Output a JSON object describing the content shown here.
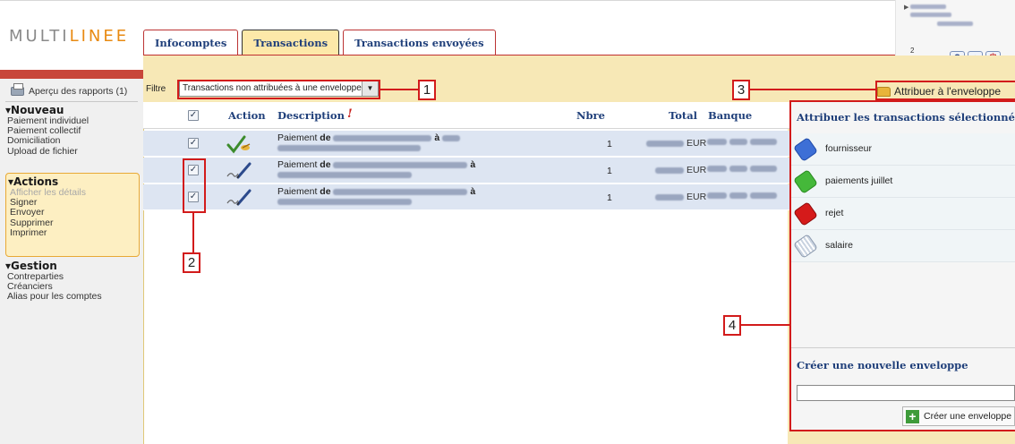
{
  "app": {
    "logo_text_gray": "MULTI",
    "logo_text_accent": "LINE",
    "logo_tail": "E"
  },
  "tabs": [
    {
      "label": "Infocomptes",
      "active": false
    },
    {
      "label": "Transactions",
      "active": true
    },
    {
      "label": "Transactions envoyées",
      "active": false
    }
  ],
  "header_buttons": {
    "help_icon": "?",
    "home_icon": "⌂",
    "logout_icon": "⏻",
    "mail_count": "2"
  },
  "sidebar": {
    "report_link": "Aperçu des rapports (1)",
    "nouveau": {
      "title": "▾Nouveau",
      "items": [
        "Paiement individuel",
        "Paiement collectif",
        "Domiciliation",
        "Upload de fichier"
      ]
    },
    "actions": {
      "title": "▾Actions",
      "items": [
        "Afficher les détails",
        "Signer",
        "Envoyer",
        "Supprimer",
        "Imprimer"
      ]
    },
    "gestion": {
      "title": "▾Gestion",
      "items": [
        "Contreparties",
        "Créanciers",
        "Alias pour les comptes"
      ]
    }
  },
  "filter": {
    "label": "Filtre",
    "selected": "Transactions non attribuées à une enveloppe"
  },
  "assign_button": {
    "label": "Attribuer à l'enveloppe"
  },
  "table": {
    "headers": {
      "flag": "!",
      "action": "Action",
      "description": "Description",
      "nbre": "Nbre",
      "total": "Total",
      "bank": "Banque"
    },
    "rows": [
      {
        "desc_prefix": "Paiement ",
        "desc_bold": "de",
        "desc_mid": " à",
        "nbre": "1",
        "currency": "EUR",
        "checked": true,
        "action": "signed"
      },
      {
        "desc_prefix": "Paiement ",
        "desc_bold": "de",
        "desc_mid": " à",
        "nbre": "1",
        "currency": "EUR",
        "checked": true,
        "action": "sign"
      },
      {
        "desc_prefix": "Paiement ",
        "desc_bold": "de",
        "desc_mid": " à",
        "nbre": "1",
        "currency": "EUR",
        "checked": true,
        "action": "sign"
      }
    ]
  },
  "envelopes": {
    "title": "Attribuer les transactions sélectionnées à",
    "items": [
      {
        "label": "fournisseur",
        "color": "#3d6fd6"
      },
      {
        "label": "paiements juillet",
        "color": "#45b83a"
      },
      {
        "label": "rejet",
        "color": "#d51a1a"
      },
      {
        "label": "salaire",
        "color": "#c9d3e0"
      }
    ],
    "new_title": "Créer une nouvelle enveloppe",
    "new_input_value": "",
    "create_button": "Créer une enveloppe"
  },
  "callouts": [
    "1",
    "2",
    "3",
    "4"
  ],
  "colors": {
    "accent_orange": "#e88a12",
    "header_red": "#c8463a",
    "callout_red": "#d21b1b",
    "panel_yellow": "#f7e8b6",
    "selected_row": "#dde5f2",
    "link_blue": "#1f3f7a"
  }
}
